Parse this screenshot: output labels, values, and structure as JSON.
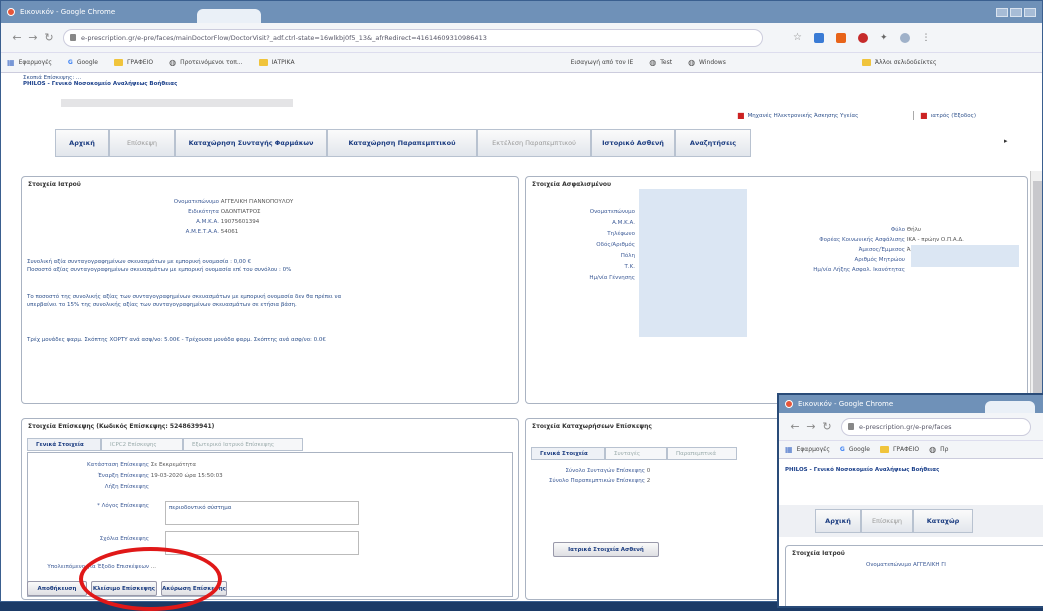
{
  "browser": {
    "title": "Εικονικόν - Google Chrome",
    "url": "e-prescription.gr/e-pre/faces/mainDoctorFlow/DoctorVisit?_adf.ctrl-state=16wlkbj0f5_13&_afrRedirect=41614609310986413",
    "bookmarks": [
      "Εφαρμογές",
      "Google",
      "ΓΡΑΦΕΙΟ",
      "Προτεινόμενοι τοπ...",
      "ΙΑΤΡΙΚΑ",
      "Εισαγωγή από τον IE",
      "Test",
      "Windows",
      "Άλλοι σελιδοδείκτες"
    ]
  },
  "header": {
    "line1": "Σκοπιά Επίσκεψης: ...",
    "line2": "PHILOS - Γενικό Νοσοκομείο Αναλήψεως Βοήθειας",
    "warning": "Μηχανές Ηλεκτρονικής Άσκησης Υγείας",
    "user": "ιατρός (Έξοδος)"
  },
  "tabs": [
    "Αρχική",
    "Επίσκεψη",
    "Καταχώρηση Συνταγής Φαρμάκων",
    "Καταχώρηση Παραπεμπτικού",
    "Εκτέλεση Παραπεμπτικού",
    "Ιστορικό Ασθενή",
    "Αναζητήσεις"
  ],
  "doctor": {
    "title": "Στοιχεία Ιατρού",
    "rows": [
      {
        "label": "Ονοματεπώνυμο",
        "value": "ΑΓΓΕΛΙΚΗ ΓΙΑΝΝΟΠΟΥΛΟΥ"
      },
      {
        "label": "Ειδικότητα",
        "value": "ΟΔΟΝΤΙΑΤΡΟΣ"
      },
      {
        "label": "Α.Μ.Κ.Α.",
        "value": "19075601394"
      },
      {
        "label": "Α.Μ.Ε.Τ.Α.Α.",
        "value": "54061"
      }
    ],
    "note1": "Συνολική αξία συνταγογραφημένων σκευασμάτων με εμπορική ονομασία : 0,00 €",
    "note2": "Ποσοστό αξίας συνταγογραφημένων σκευασμάτων με εμπορική ονομασία επί του συνόλου : 0%",
    "note3": "Το ποσοστό της συνολικής αξίας των συνταγογραφημένων σκευασμάτων με εμπορική ονομασία δεν θα πρέπει να",
    "note4": "υπερβαίνει το 15% της συνολικής αξίας των συνταγογραφημένων σκευασμάτων σε ετήσια βάση.",
    "note5": "Τρέχ μονάδες φαρμ. Σκόπτης ΧΟΡΤΥ ανά ασφ/νο: 5.00€ - Τρέχουσα μονάδα φαρμ. Σκόπτης ανά ασφ/νο: 0.0€"
  },
  "insured": {
    "title": "Στοιχεία Ασφαλισμένου",
    "left_labels": [
      "Ονοματεπώνυμο",
      "Α.Μ.Κ.Α.",
      "Τηλέφωνο",
      "Οδός/Αριθμός",
      "Πόλη",
      "Τ.Κ.",
      "Ημ/νία Γέννησης"
    ],
    "right_rows": [
      {
        "label": "Φύλο",
        "value": "Θήλυ"
      },
      {
        "label": "Φορέας Κοινωνικής Ασφάλισης",
        "value": "ΙΚΑ - πρώην Ο.Π.Α.Δ."
      },
      {
        "label": "Άμεσος/Έμμεσος",
        "value": "Άμεσος"
      },
      {
        "label": "Αριθμός Μητρώου",
        "value": ""
      },
      {
        "label": "Ημ/νία Λήξης Ασφαλ. Ικανότητας",
        "value": ""
      }
    ]
  },
  "visit": {
    "title": "Στοιχεία Επίσκεψης (Κωδικός Επίσκεψης: 5248639941)",
    "subtabs": [
      "Γενικά Στοιχεία",
      "ICPC2 Επίσκεψης",
      "Εξωτερικό Ιατρικό Επίσκεψης"
    ],
    "rows": [
      {
        "label": "Κατάσταση Επίσκεψης",
        "value": "Σε Εκκρεμότητα"
      },
      {
        "label": "Έναρξη Επίσκεψης",
        "value": "19-03-2020 ώρα 15:50:03"
      },
      {
        "label": "Λήξη Επίσκεψης",
        "value": ""
      },
      {
        "label": "* Λόγος Επίσκεψης",
        "value": "περιοδοντικό σύστημα"
      },
      {
        "label": "Σχόλια Επίσκεψης",
        "value": ""
      },
      {
        "label": "Υπολειπόμενο για Έξοδο Επισκέψεων",
        "value": "..."
      }
    ],
    "buttons": [
      "Αποθήκευση",
      "Κλείσιμο Επίσκεψης",
      "Ακύρωση Επίσκεψης"
    ]
  },
  "registrations": {
    "title": "Στοιχεία Καταχωρήσεων Επίσκεψης",
    "subtabs": [
      "Γενικά Στοιχεία",
      "Συνταγές",
      "Παραπεμπτικά"
    ],
    "rows": [
      {
        "label": "Σύνολο Συνταγών Επίσκεψης",
        "value": "0"
      },
      {
        "label": "Σύνολο Παραπεμπτικών Επίσκεψης",
        "value": "2"
      }
    ],
    "button": "Ιατρικά Στοιχεία Ασθενή"
  },
  "second_window": {
    "title": "Εικονικόν - Google Chrome",
    "url": "e-prescription.gr/e-pre/faces",
    "bookmarks": [
      "Εφαρμογές",
      "Google",
      "ΓΡΑΦΕΙΟ",
      "Πρ"
    ],
    "header": "PHILOS - Γενικό Νοσοκομείο Αναλήψεως Βοήθειας",
    "tabs": [
      "Αρχική",
      "Επίσκεψη",
      "Καταχώρ"
    ],
    "panel_title": "Στοιχεία Ιατρού",
    "row": "Ονοματεπώνυμο  ΑΓΓΕΛΙΚΗ ΓΙ"
  },
  "colors": {
    "annotation": "#e01818",
    "link": "#1b3c80",
    "titlebar": "#6f91b8"
  }
}
